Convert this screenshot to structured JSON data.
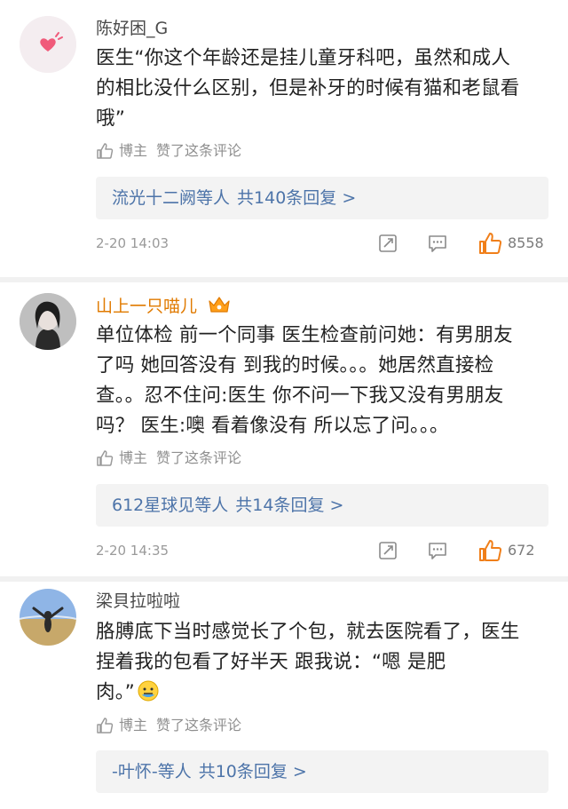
{
  "comments": [
    {
      "user": "陈好困_G",
      "text_lines": [
        "医生“你这个年龄还是挂儿童牙科吧，虽然和成人",
        "的相比没什么区别，但是补牙的时候有猫和老鼠看",
        "哦”"
      ],
      "liked_author": "博主",
      "liked_text": "赞了这条评论",
      "replies_names": "流光十二阙等人",
      "replies_count": "共140条回复 >",
      "time": "2-20 14:03",
      "likes": "8558"
    },
    {
      "user": "山上一只喵儿",
      "text_lines": [
        "单位体检 前一个同事 医生检查前问她：有男朋友",
        "了吗 她回答没有 到我的时候。。。她居然直接检",
        "查。。忍不住问:医生 你不问一下我又没有男朋友",
        "吗？ 医生:噢 看着像没有 所以忘了问。。。"
      ],
      "liked_author": "博主",
      "liked_text": "赞了这条评论",
      "replies_names": "612星球见等人",
      "replies_count": "共14条回复 >",
      "time": "2-20 14:35",
      "likes": "672"
    },
    {
      "user": "梁貝拉啦啦",
      "text_lines": [
        "胳膊底下当时感觉长了个包，就去医院看了，医生",
        "捏着我的包看了好半天 跟我说：“嗯 是肥",
        "肉。”"
      ],
      "liked_author": "博主",
      "liked_text": "赞了这条评论",
      "replies_names": "-叶怀-等人",
      "replies_count": "共10条回复 >",
      "time": "",
      "likes": ""
    }
  ],
  "colors": {
    "accent_link": "#4d74a9",
    "vip_name": "#e07a00",
    "like_orange": "#f07f1a",
    "separator": "#f1f1f1"
  },
  "icons": [
    "heart-avatar-icon",
    "vip-crown-icon",
    "thumb-up-icon",
    "share-icon",
    "comment-icon",
    "like-icon",
    "emoji-icon"
  ]
}
